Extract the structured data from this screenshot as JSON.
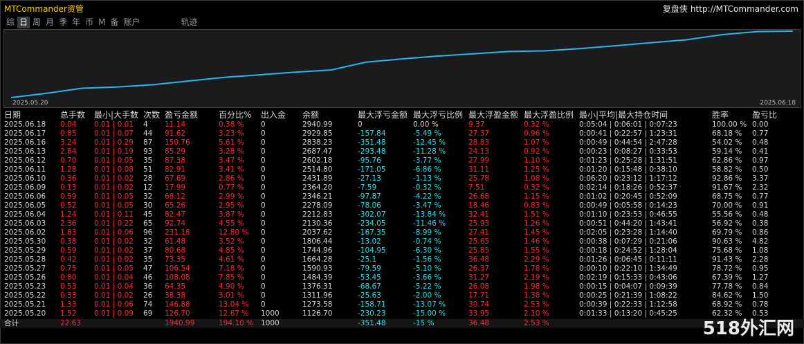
{
  "header": {
    "app_title": "MTCommander资管",
    "site_cn": "复盘侠",
    "site_url": "http://MTCommander.com"
  },
  "tabs": [
    {
      "label": "综",
      "active": false
    },
    {
      "label": "日",
      "active": true
    },
    {
      "label": "周",
      "active": false
    },
    {
      "label": "月",
      "active": false
    },
    {
      "label": "季",
      "active": false
    },
    {
      "label": "年",
      "active": false
    },
    {
      "label": "币",
      "active": false
    },
    {
      "label": "M",
      "active": false
    },
    {
      "label": "备",
      "active": false
    },
    {
      "label": "账户",
      "active": false
    },
    {
      "label": "轨迹",
      "active": false
    }
  ],
  "chart": {
    "start_date": "2025.05.20",
    "end_date": "2025.06.18",
    "line_color": "#29b6f6"
  },
  "table": {
    "headers": [
      "日期",
      "总手数",
      "最小|大手数",
      "次数",
      "盈亏金额",
      "百分比%",
      "出入金",
      "余额",
      "最大浮亏金额",
      "最大浮亏比例",
      "最大浮盈金额",
      "最大浮盈比例",
      "最小|平均|最大持仓时间",
      "胜率",
      "盈亏比"
    ],
    "rows": [
      [
        "2025.06.18",
        "0.04",
        "0.01 | 0.01",
        "4",
        "11.14",
        "0.38 %",
        "0",
        "2940.99",
        "0",
        "0.00 %",
        "9.37",
        "0.32 %",
        "0:05:04 | 0:06:01 | 0:07:23",
        "100.00 %",
        "0.00"
      ],
      [
        "2025.06.17",
        "0.85",
        "0.01 | 0.07",
        "44",
        "91.62",
        "3.23 %",
        "0",
        "2929.85",
        "-157.84",
        "-5.49 %",
        "27.37",
        "0.96 %",
        "0:00:41 | 0:22:57 | 1:23:31",
        "68.18 %",
        "0.77"
      ],
      [
        "2025.06.16",
        "3.24",
        "0.01 | 0.29",
        "87",
        "150.76",
        "5.61 %",
        "0",
        "2838.23",
        "-351.48",
        "-12.45 %",
        "28.83",
        "1.07 %",
        "0:00:49 | 0:44:54 | 2:47:28",
        "54.02 %",
        "0.48"
      ],
      [
        "2025.06.13",
        "2.84",
        "0.01 | 0.19",
        "93",
        "85.29",
        "3.28 %",
        "0",
        "2687.47",
        "-293.48",
        "-11.28 %",
        "24.13",
        "0.92 %",
        "0:00:23 | 0:08:27 | 0:33:53",
        "59.14 %",
        "0.41"
      ],
      [
        "2025.06.12",
        "0.70",
        "0.01 | 0.05",
        "35",
        "87.38",
        "3.47 %",
        "0",
        "2602.18",
        "-95.76",
        "-3.77 %",
        "27.99",
        "1.10 %",
        "0:01:23 | 0:25:28 | 1:31:51",
        "62.86 %",
        "0.97"
      ],
      [
        "2025.06.11",
        "1.28",
        "0.01 | 0.08",
        "51",
        "82.91",
        "3.41 %",
        "0",
        "2514.80",
        "-171.05",
        "-6.86 %",
        "31.11",
        "1.25 %",
        "0:01:20 | 0:15:48 | 0:38:10",
        "58.82 %",
        "0.50"
      ],
      [
        "2025.06.10",
        "0.36",
        "0.01 | 0.02",
        "28",
        "67.69",
        "2.86 %",
        "0",
        "2431.89",
        "-27.13",
        "-1.13 %",
        "25.78",
        "1.08 %",
        "0:06:20 | 0:23:12 | 1:17:12",
        "92.86 %",
        "3.37"
      ],
      [
        "2025.06.09",
        "0.13",
        "0.01 | 0.02",
        "12",
        "17.99",
        "0.77 %",
        "0",
        "2364.20",
        "-7.59",
        "-0.32 %",
        "7.51",
        "0.32 %",
        "0:02:14 | 0:18:26 | 0:52:37",
        "91.67 %",
        "2.32"
      ],
      [
        "2025.06.06",
        "0.59",
        "0.01 | 0.05",
        "32",
        "68.12",
        "2.99 %",
        "0",
        "2346.21",
        "-97.87",
        "-4.22 %",
        "26.68",
        "1.15 %",
        "0:01:02 | 0:20:45 | 0:52:09",
        "68.75 %",
        "0.77"
      ],
      [
        "2025.06.05",
        "0.52",
        "0.01 | 0.05",
        "30",
        "65.26",
        "2.95 %",
        "0",
        "2278.09",
        "-78.06",
        "-3.47 %",
        "18.46",
        "0.83 %",
        "0:00:49 | 0:05:58 | 0:14:23",
        "70.00 %",
        "0.91"
      ],
      [
        "2025.06.04",
        "1.24",
        "0.01 | 0.11",
        "45",
        "82.47",
        "3.87 %",
        "0",
        "2212.83",
        "-302.07",
        "-13.84 %",
        "32.41",
        "1.51 %",
        "0:01:10 | 0:23:53 | 0:46:55",
        "55.56 %",
        "0.48"
      ],
      [
        "2025.06.03",
        "2.36",
        "0.01 | 0.22",
        "65",
        "92.74",
        "4.55 %",
        "0",
        "2130.36",
        "-234.05",
        "-11.46 %",
        "25.93",
        "1.26 %",
        "0:00:51 | 0:44:20 | 1:43:41",
        "56.92 %",
        "0.38"
      ],
      [
        "2025.06.02",
        "1.83",
        "0.01 | 0.06",
        "96",
        "231.18",
        "12.80 %",
        "0",
        "2037.62",
        "-167.35",
        "-8.99 %",
        "27.41",
        "1.45 %",
        "0:02:05 | 0:23:28 | 1:14:40",
        "69.79 %",
        "0.86"
      ],
      [
        "2025.05.30",
        "0.38",
        "0.01 | 0.02",
        "32",
        "61.48",
        "3.52 %",
        "0",
        "1806.44",
        "-13.02",
        "-0.74 %",
        "25.65",
        "1.46 %",
        "0:00:38 | 0:07:29 | 0:21:06",
        "90.63 %",
        "4.82"
      ],
      [
        "2025.05.29",
        "0.59",
        "0.01 | 0.02",
        "37",
        "80.68",
        "4.85 %",
        "0",
        "1744.96",
        "-104.95",
        "-6.30 %",
        "25.85",
        "1.55 %",
        "0:00:18 | 0:24:52 | 1:28:04",
        "75.68 %",
        "1.08"
      ],
      [
        "2025.05.28",
        "0.42",
        "0.01 | 0.02",
        "35",
        "73.35",
        "4.61 %",
        "0",
        "1664.28",
        "-25.1",
        "-1.56 %",
        "36.48",
        "2.29 %",
        "0:01:26 | 0:06:45 | 0:11:11",
        "91.43 %",
        "2.28"
      ],
      [
        "2025.05.27",
        "0.75",
        "0.01 | 0.05",
        "47",
        "106.54",
        "7.18 %",
        "0",
        "1590.93",
        "-79.59",
        "-5.10 %",
        "26.37",
        "1.78 %",
        "0:00:10 | 0:22:10 | 1:34:49",
        "78.72 %",
        "0.95"
      ],
      [
        "2025.05.26",
        "0.80",
        "0.01 | 0.04",
        "46",
        "108.08",
        "7.85 %",
        "0",
        "1484.39",
        "-53.45",
        "-3.66 %",
        "31.27",
        "2.19 %",
        "0:02:19 | 0:15:33 | 0:43:06",
        "67.39 %",
        "1.27"
      ],
      [
        "2025.05.23",
        "0.53",
        "0.01 | 0.04",
        "36",
        "64.35",
        "4.90 %",
        "0",
        "1376.31",
        "-68.67",
        "-5.22 %",
        "26.08",
        "1.98 %",
        "0:00:15 | 0:04:07 | 0:09:39",
        "77.78 %",
        "0.84"
      ],
      [
        "2025.05.22",
        "0.33",
        "0.01 | 0.02",
        "26",
        "38.38",
        "3.01 %",
        "0",
        "1311.96",
        "-25.63",
        "-2.00 %",
        "17.71",
        "1.38 %",
        "0:00:25 | 0:21:39 | 1:08:22",
        "84.62 %",
        "1.50"
      ],
      [
        "2025.05.21",
        "1.33",
        "0.01 | 0.06",
        "74",
        "146.88",
        "13.04 %",
        "0",
        "1273.58",
        "-158.71",
        "-13.07 %",
        "30.74",
        "2.53 %",
        "0:00:39 | 0:22:33 | 1:12:58",
        "68.92 %",
        "0.78"
      ],
      [
        "2025.05.20",
        "1.52",
        "0.01 | 0.09",
        "69",
        "126.70",
        "12.67 %",
        "1000",
        "1126.70",
        "-230.23",
        "-15.00 %",
        "33.95",
        "2.10 %",
        "0:01:33 | 0:13:20 | 0:45:25",
        "62.32 %",
        "0.53"
      ]
    ],
    "total": [
      "合计",
      "22.63",
      "",
      "",
      "1940.99",
      "194.10 %",
      "1000",
      "",
      "-351.48",
      "-15 %",
      "36.48",
      "2.53 %",
      "",
      "",
      ""
    ]
  },
  "watermark": {
    "text": "518外汇网"
  },
  "colors": {
    "positive": "#ff2a2a",
    "negative": "#29e1ec",
    "neutral": "#d4d4d4",
    "title": "#ffd200"
  }
}
